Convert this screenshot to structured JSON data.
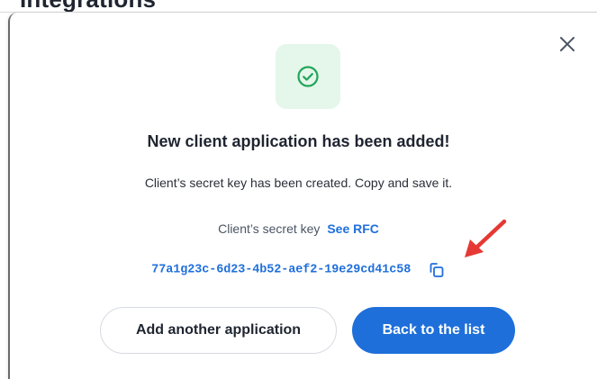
{
  "background": {
    "heading": "Integrations"
  },
  "modal": {
    "title": "New client application has been added!",
    "subtitle": "Client’s secret key has been created. Copy and save it.",
    "secret_key_label": "Client’s secret key",
    "see_rfc_link": "See RFC",
    "secret_key_value": "77a1g23c-6d23-4b52-aef2-19e29cd41c58",
    "buttons": {
      "secondary_label": "Add another application",
      "primary_label": "Back to the list"
    },
    "icons": {
      "close": "close-icon",
      "success": "check-circle-icon",
      "copy": "copy-icon",
      "annotation": "red-arrow-annotation"
    },
    "colors": {
      "accent": "#1e6fd9",
      "success": "#22a55a",
      "success_bg": "#e4f7ea",
      "annotation": "#e53935"
    }
  }
}
